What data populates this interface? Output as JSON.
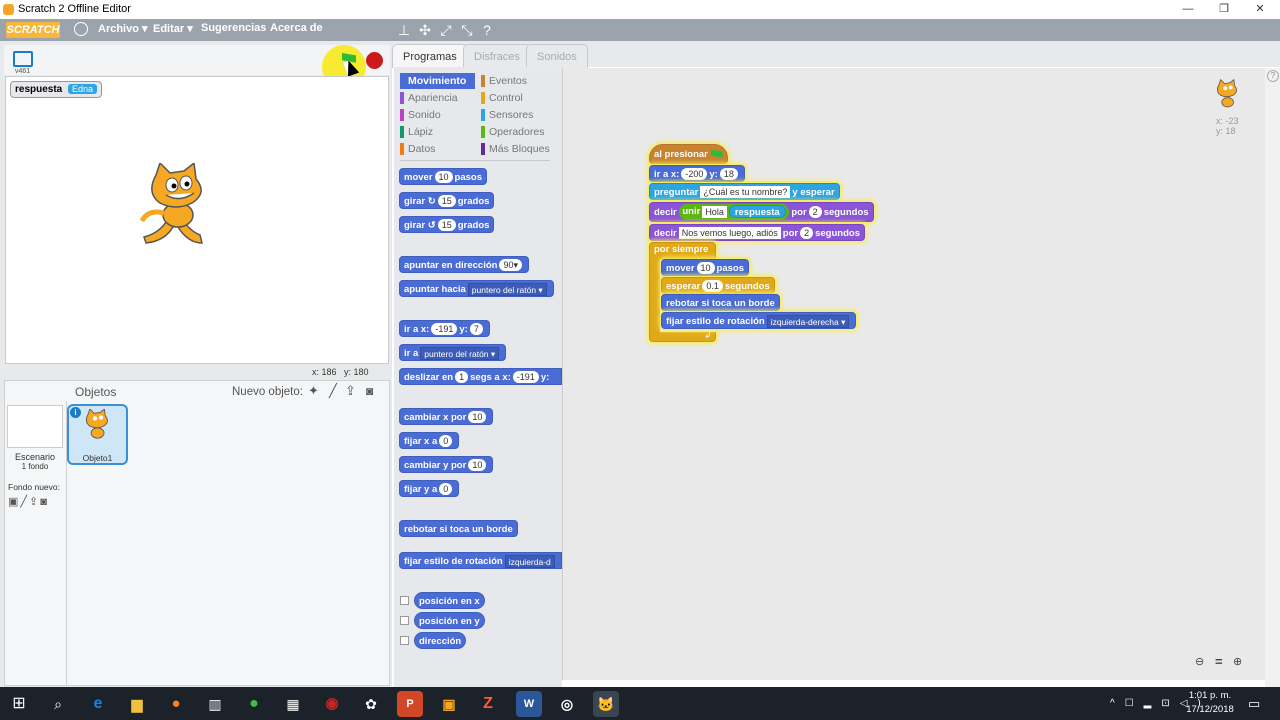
{
  "window": {
    "title": "Scratch 2 Offline Editor",
    "minimize": "—",
    "restore": "❐",
    "close": "✕"
  },
  "menubar": {
    "logo": "SCRATCH",
    "items": [
      "Archivo ▾",
      "Editar ▾",
      "Sugerencias",
      "Acerca de"
    ]
  },
  "stage": {
    "version": "v461",
    "monitor_label": "respuesta",
    "monitor_value": "Edna",
    "coords_x": "x: 186",
    "coords_y": "y: 180"
  },
  "sprites": {
    "header": "Objetos",
    "new_sprite": "Nuevo objeto:",
    "stage_label": "Escenario",
    "stage_sub": "1 fondo",
    "new_backdrop": "Fondo nuevo:",
    "sprite1": "Objeto1"
  },
  "tabs": [
    "Programas",
    "Disfraces",
    "Sonidos"
  ],
  "categories": {
    "left": [
      {
        "label": "Movimiento",
        "color": "#4a6cd4"
      },
      {
        "label": "Apariencia",
        "color": "#8a55d7"
      },
      {
        "label": "Sonido",
        "color": "#bb42c3"
      },
      {
        "label": "Lápiz",
        "color": "#0e9a6c"
      },
      {
        "label": "Datos",
        "color": "#ee7d16"
      }
    ],
    "right": [
      {
        "label": "Eventos",
        "color": "#c88330"
      },
      {
        "label": "Control",
        "color": "#e1a91a"
      },
      {
        "label": "Sensores",
        "color": "#2ca5e2"
      },
      {
        "label": "Operadores",
        "color": "#5cb712"
      },
      {
        "label": "Más Bloques",
        "color": "#632d99"
      }
    ]
  },
  "palette": {
    "move": "mover",
    "move_n": "10",
    "steps": "pasos",
    "turn": "girar",
    "turn_n": "15",
    "degrees": "grados",
    "point_dir": "apuntar en dirección",
    "dir_n": "90▾",
    "point_to": "apuntar hacia",
    "mouse": "puntero del ratón ▾",
    "goto_xy": "ir a x:",
    "gx": "-191",
    "gy_lbl": "y:",
    "gy": "7",
    "goto": "ir a",
    "mouse2": "puntero del ratón ▾",
    "glide": "deslizar en",
    "glide_n": "1",
    "glide_mid": "segs a x:",
    "glide_x": "-191",
    "glide_y": "y:",
    "change_x": "cambiar x por",
    "cx": "10",
    "set_x": "fijar x a",
    "sx": "0",
    "change_y": "cambiar y por",
    "cy": "10",
    "set_y": "fijar y a",
    "sy": "0",
    "bounce": "rebotar si toca un borde",
    "rot_style": "fijar estilo de rotación",
    "rot_val": "izquierda-d",
    "xpos": "posición en x",
    "ypos": "posición en y",
    "direction": "dirección"
  },
  "script": {
    "hat": "al presionar",
    "goto": "ir a x:",
    "x": "-200",
    "y_lbl": "y:",
    "y": "18",
    "ask": "preguntar",
    "ask_text": "¿Cuál es tu nombre?",
    "ask_wait": "y esperar",
    "say": "decir",
    "join": "unir",
    "hola": "Hola",
    "answer": "respuesta",
    "for": "por",
    "say_n": "2",
    "secs": "segundos",
    "say2": "decir",
    "bye": "Nos vemos luego, adiós",
    "for2": "por",
    "say2_n": "2",
    "secs2": "segundos",
    "forever": "por siempre",
    "move": "mover",
    "move_n": "10",
    "steps": "pasos",
    "wait": "esperar",
    "wait_n": "0.1",
    "wait_secs": "segundos",
    "bounce": "rebotar si toca un borde",
    "rot": "fijar estilo de rotación",
    "rot_val": "izquierda-derecha ▾",
    "sprite_x": "x: -23",
    "sprite_y": "y: 18"
  },
  "zoom": {
    "out": "🔍",
    "reset": "=",
    "in": "🔍"
  },
  "taskbar": {
    "time": "1:01 p. m.",
    "date": "17/12/2018"
  }
}
